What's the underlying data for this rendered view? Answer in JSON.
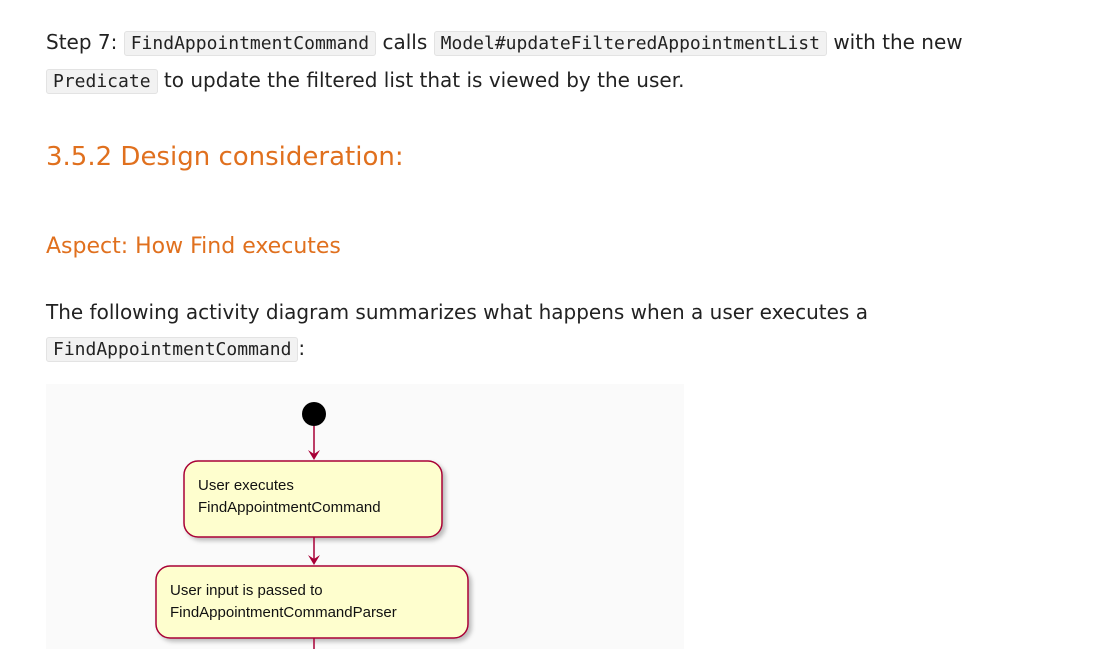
{
  "step7": {
    "lead": "Step 7:",
    "code1": "FindAppointmentCommand",
    "mid1": "calls",
    "code2": "Model#updateFilteredAppointmentList",
    "mid2": "with the new",
    "code3": "Predicate",
    "tail": "to update the filtered list that is viewed by the user."
  },
  "section_heading": "3.5.2 Design consideration:",
  "aspect_heading": "Aspect: How Find executes",
  "activity_intro": {
    "text": "The following activity diagram summarizes what happens when a user executes a",
    "code": "FindAppointmentCommand",
    "tail": ":"
  },
  "diagram": {
    "node1": {
      "line1": "User executes",
      "line2": "FindAppointmentCommand"
    },
    "node2": {
      "line1": "User input is passed to",
      "line2": "FindAppointmentCommandParser"
    },
    "colors": {
      "node_fill": "#fefece",
      "node_border": "#a80036",
      "arrow": "#a80036",
      "start": "#000000"
    }
  }
}
